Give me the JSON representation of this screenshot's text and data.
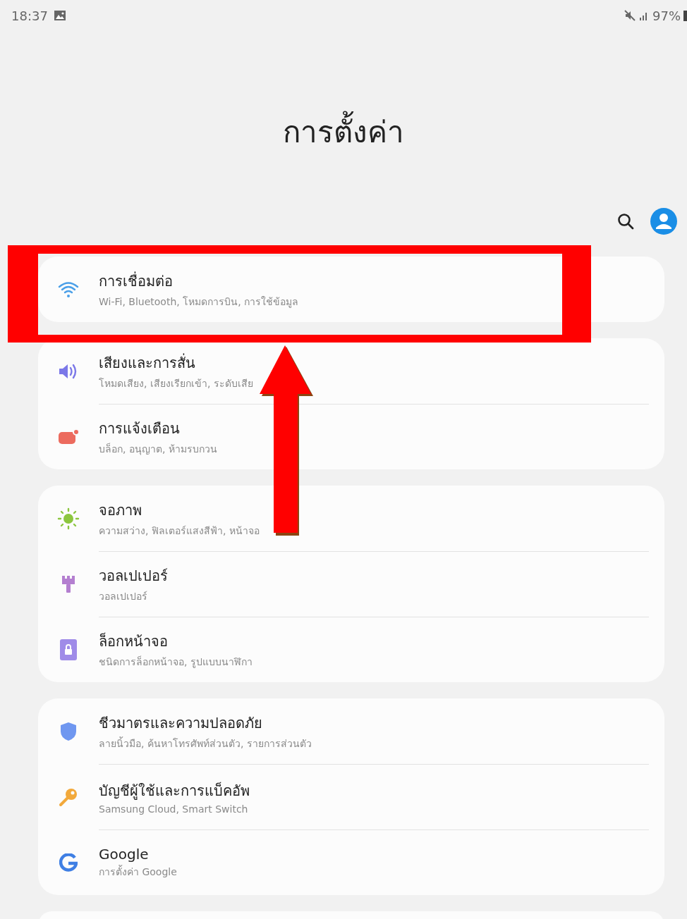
{
  "status_bar": {
    "time": "18:37",
    "battery": "97%"
  },
  "title": "การตั้งค่า",
  "groups": [
    {
      "items": [
        {
          "title": "การเชื่อมต่อ",
          "subtitle": "Wi-Fi, Bluetooth, โหมดการบิน, การใช้ข้อมูล"
        }
      ]
    },
    {
      "items": [
        {
          "title": "เสียงและการสั่น",
          "subtitle": "โหมดเสียง, เสียงเรียกเข้า, ระดับเสีย"
        },
        {
          "title": "การแจ้งเตือน",
          "subtitle": "บล็อก, อนุญาต, ห้ามรบกวน"
        }
      ]
    },
    {
      "items": [
        {
          "title": "จอภาพ",
          "subtitle": "ความสว่าง, ฟิลเตอร์แสงสีฟ้า, หน้าจอ"
        },
        {
          "title": "วอลเปเปอร์",
          "subtitle": "วอลเปเปอร์"
        },
        {
          "title": "ล็อกหน้าจอ",
          "subtitle": "ชนิดการล็อกหน้าจอ, รูปแบบนาฬิกา"
        }
      ]
    },
    {
      "items": [
        {
          "title": "ชีวมาตรและความปลอดภัย",
          "subtitle": "ลายนิ้วมือ, ค้นหาโทรศัพท์ส่วนตัว, รายการส่วนตัว"
        },
        {
          "title": "บัญชีผู้ใช้และการแบ็คอัพ",
          "subtitle": "Samsung Cloud, Smart Switch"
        },
        {
          "title": "Google",
          "subtitle": "การตั้งค่า Google"
        }
      ]
    }
  ]
}
